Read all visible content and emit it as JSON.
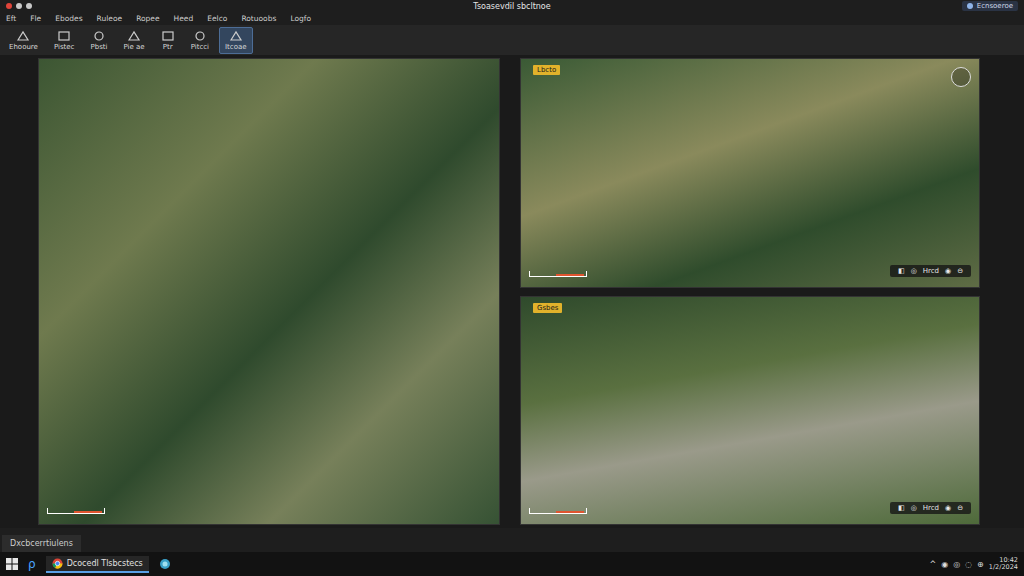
{
  "window": {
    "title": "Tsoasevdil sbcltnoe"
  },
  "account": {
    "label": "Ecnsoeroe"
  },
  "menu": [
    "Eft",
    "Fle",
    "Ebodes",
    "Ruleoe",
    "Ropee",
    "Heed",
    "Eelco",
    "Rotuoobs",
    "Logfo"
  ],
  "toolbar": [
    {
      "label": "Ehooure",
      "selected": false
    },
    {
      "label": "Pistec",
      "selected": false
    },
    {
      "label": "Pbsti",
      "selected": false
    },
    {
      "label": "Pie ae",
      "selected": false
    },
    {
      "label": "Ptr",
      "selected": false
    },
    {
      "label": "Pitcci",
      "selected": false
    },
    {
      "label": "Itcoae",
      "selected": true
    }
  ],
  "side_views": [
    {
      "badge": "Lbcto",
      "compass": true,
      "controls": [
        "◧",
        "◎",
        "Hrcd",
        "◉",
        "⊖"
      ]
    },
    {
      "badge": "Gsbes",
      "compass": false,
      "controls": [
        "◧",
        "◎",
        "Hrcd",
        "◉",
        "⊖"
      ]
    }
  ],
  "status_bar": {
    "tab": "Dxcbcerrtiulens"
  },
  "taskbar": {
    "search": "ρ",
    "app_label": "Dcocedl Tlsbcstecs",
    "tray": [
      "^",
      "◉",
      "◎",
      "◌",
      "⊕"
    ],
    "clock": "10:42",
    "date": "1/2/2024"
  }
}
